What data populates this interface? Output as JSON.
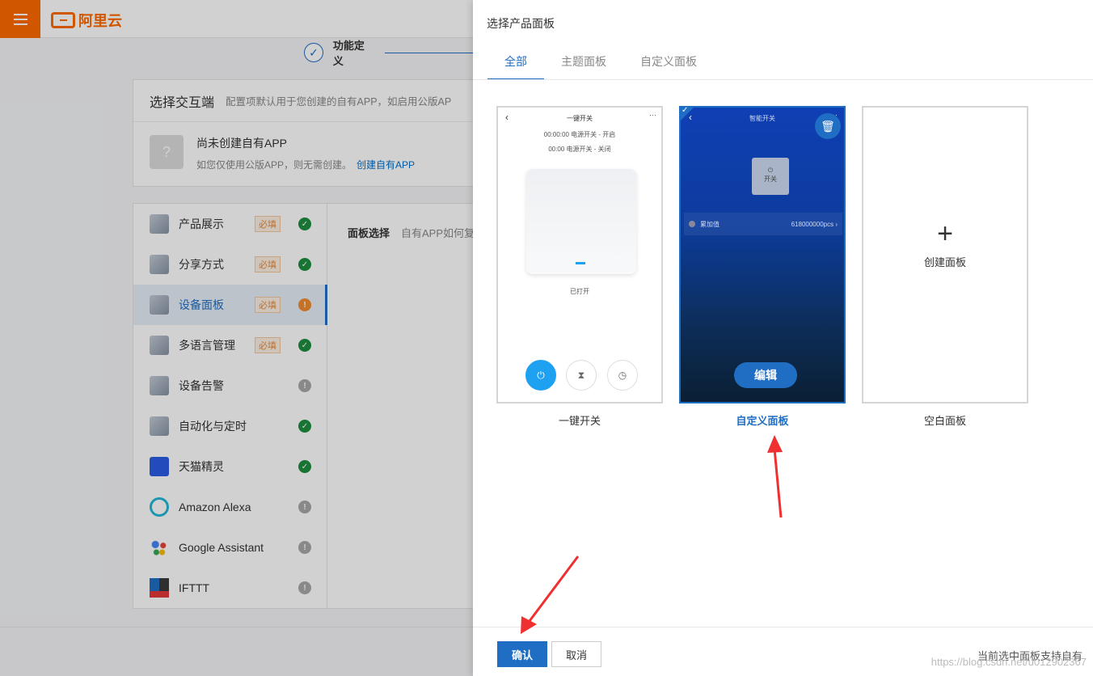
{
  "brand": {
    "name": "阿里云"
  },
  "stepper": {
    "current": "功能定义"
  },
  "interaction": {
    "title": "选择交互端",
    "desc": "配置项默认用于您创建的自有APP，如启用公版AP",
    "empty_title": "尚未创建自有APP",
    "empty_desc": "如您仅使用公版APP，则无需创建。",
    "create_link": "创建自有APP",
    "empty_icon": "?"
  },
  "sidebar": {
    "required_badge": "必填",
    "items": [
      {
        "label": "产品展示",
        "required": true,
        "status": "ok"
      },
      {
        "label": "分享方式",
        "required": true,
        "status": "ok"
      },
      {
        "label": "设备面板",
        "required": true,
        "status": "warn",
        "active": true
      },
      {
        "label": "多语言管理",
        "required": true,
        "status": "ok"
      },
      {
        "label": "设备告警",
        "required": false,
        "status": "grey"
      },
      {
        "label": "自动化与定时",
        "required": false,
        "status": "ok"
      },
      {
        "label": "天猫精灵",
        "required": false,
        "status": "ok"
      },
      {
        "label": "Amazon Alexa",
        "required": false,
        "status": "grey"
      },
      {
        "label": "Google Assistant",
        "required": false,
        "status": "grey"
      },
      {
        "label": "IFTTT",
        "required": false,
        "status": "grey"
      }
    ]
  },
  "panel_select": {
    "title": "面板选择",
    "desc": "自有APP如何复"
  },
  "drawer": {
    "title": "选择产品面板",
    "tabs": [
      "全部",
      "主题面板",
      "自定义面板"
    ],
    "active_tab": "全部",
    "cards": [
      {
        "name": "一键开关",
        "mock": {
          "header": "一键开关",
          "line1": "00:00:00 电源开关 - 开启",
          "line2": "00:00 电源开关 - 关闭",
          "state": "已打开"
        }
      },
      {
        "name": "自定义面板",
        "selected": true,
        "mock": {
          "header": "智能开关",
          "power": "开关",
          "row_label": "累加值",
          "row_value": "618000000pcs",
          "edit": "编辑"
        }
      },
      {
        "name": "空白面板",
        "create_label": "创建面板"
      }
    ],
    "footer": {
      "confirm": "确认",
      "cancel": "取消",
      "note": "当前选中面板支持自有",
      "watermark": "https://blog.csdn.net/u012902367"
    }
  },
  "colors": {
    "brand_orange": "#ff6a00",
    "primary_blue": "#1f6ec4",
    "ok_green": "#1e8e3e",
    "warn_orange": "#f08c2e",
    "annotation_red": "#f03030"
  },
  "icons": [
    "menu-icon",
    "check-icon",
    "trash-icon",
    "plus-icon",
    "power-icon",
    "hourglass-icon",
    "clock-icon",
    "chevron-left-icon",
    "more-icon"
  ]
}
